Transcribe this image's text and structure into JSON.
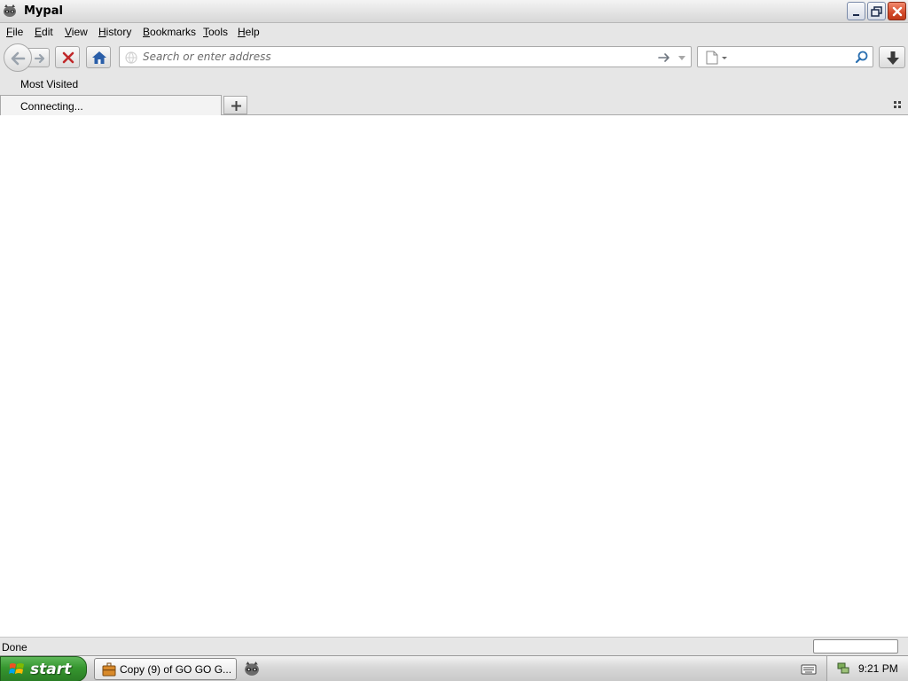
{
  "window": {
    "title": "Mypal",
    "icon": "mypal-raccoon-icon",
    "controls": [
      "minimize",
      "maximize",
      "close"
    ]
  },
  "menu": {
    "items": [
      {
        "label": "File",
        "accel": "F",
        "rest": "ile"
      },
      {
        "label": "Edit",
        "accel": "E",
        "rest": "dit"
      },
      {
        "label": "View",
        "accel": "V",
        "rest": "iew"
      },
      {
        "label": "History",
        "accel": "H",
        "rest": "istory"
      },
      {
        "label": "Bookmarks",
        "accel": "B",
        "rest": "ookmarks"
      },
      {
        "label": "Tools",
        "accel": "T",
        "rest": "ools"
      },
      {
        "label": "Help",
        "accel": "H",
        "rest": "elp"
      }
    ]
  },
  "navbar": {
    "url_placeholder": "Search or enter address",
    "url_value": "",
    "search_value": "",
    "buttons": [
      "back",
      "forward",
      "stop",
      "home",
      "downloads"
    ]
  },
  "bookmarks": {
    "items": [
      "Most Visited"
    ]
  },
  "tabs": [
    {
      "label": "Connecting...",
      "active": true
    }
  ],
  "status": {
    "text": "Done"
  },
  "taskbar": {
    "start_label": "start",
    "tasks": [
      {
        "label": "Copy (9) of GO GO G...",
        "icon": "briefcase-icon"
      }
    ],
    "quick_launch": [
      "mypal-raccoon-icon"
    ],
    "clock": "9:21 PM"
  },
  "colors": {
    "chrome_bg": "#e6e6e6",
    "start_green": "#36962f",
    "close_red": "#d24a2a",
    "home_blue": "#2a5ea8",
    "stop_red": "#c0282a"
  }
}
